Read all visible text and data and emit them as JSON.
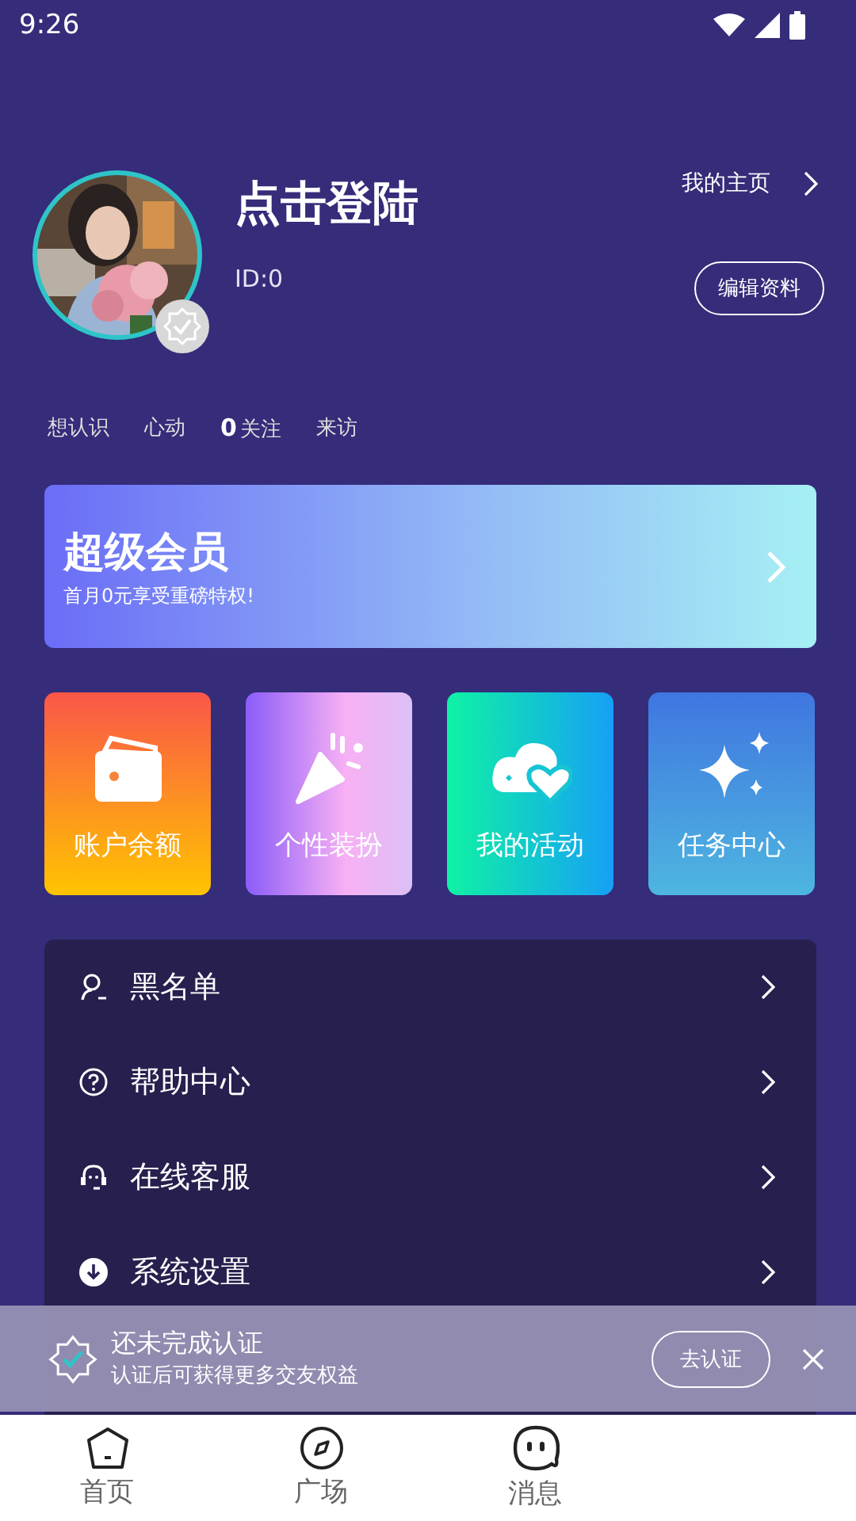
{
  "status_bar": {
    "time": "9:26"
  },
  "profile": {
    "name": "点击登陆",
    "id": "ID:0",
    "home_link": "我的主页",
    "edit_button": "编辑资料",
    "verified": false
  },
  "stats": [
    {
      "label": "想认识"
    },
    {
      "label": "心动"
    },
    {
      "count": "0",
      "label": "关注"
    },
    {
      "label": "来访"
    }
  ],
  "vip_banner": {
    "title": "超级会员",
    "subtitle": "首月0元享受重磅特权!"
  },
  "tiles": [
    {
      "kind": "wallet",
      "label": "账户余额"
    },
    {
      "kind": "party",
      "label": "个性装扮"
    },
    {
      "kind": "hearts",
      "label": "我的活动"
    },
    {
      "kind": "sparkle",
      "label": "任务中心"
    }
  ],
  "menu": [
    {
      "kind": "user",
      "label": "黑名单"
    },
    {
      "kind": "help",
      "label": "帮助中心"
    },
    {
      "kind": "service",
      "label": "在线客服"
    },
    {
      "kind": "settings",
      "label": "系统设置"
    }
  ],
  "toast": {
    "title": "还未完成认证",
    "subtitle": "认证后可获得更多交友权益",
    "button": "去认证"
  },
  "tabs": [
    {
      "kind": "home",
      "label": "首页",
      "selected": false
    },
    {
      "kind": "compass",
      "label": "广场",
      "selected": false
    },
    {
      "kind": "chat",
      "label": "消息",
      "selected": false
    }
  ]
}
